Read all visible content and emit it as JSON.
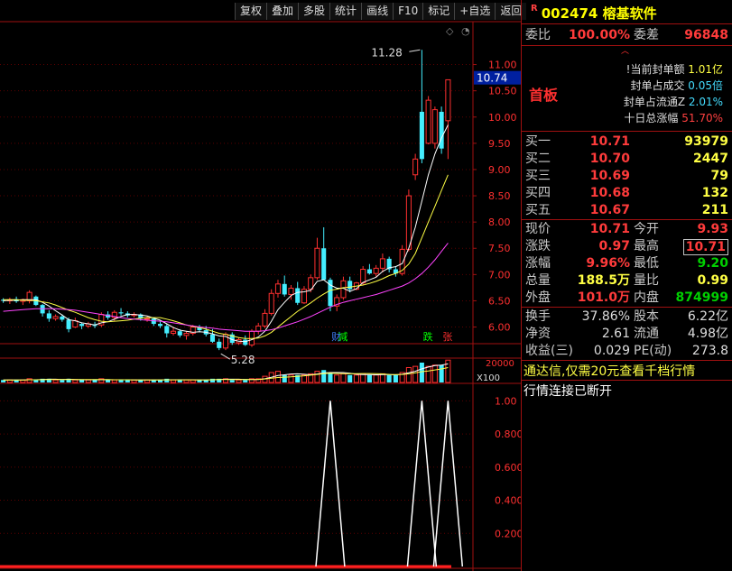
{
  "toolbar": {
    "buttons": [
      "复权",
      "叠加",
      "多股",
      "统计",
      "画线",
      "F10",
      "标记",
      "+自选",
      "返回"
    ]
  },
  "stock": {
    "r_tag": "R",
    "code": "002474",
    "name": "榕基软件"
  },
  "order_book": {
    "weibi_label": "委比",
    "weibi_value": "100.00%",
    "weicha_label": "委差",
    "weicha_value": "96848",
    "board_label": "首板",
    "seal": [
      {
        "label": "!当前封单额",
        "value": "1.01亿"
      },
      {
        "label": "封单占成交",
        "value": "0.05倍"
      },
      {
        "label": "封单占流通Z",
        "value": "2.01%"
      },
      {
        "label": "十日总涨幅",
        "value": "51.70%"
      }
    ],
    "buy": [
      {
        "label": "买一",
        "price": "10.71",
        "vol": "93979"
      },
      {
        "label": "买二",
        "price": "10.70",
        "vol": "2447"
      },
      {
        "label": "买三",
        "price": "10.69",
        "vol": "79"
      },
      {
        "label": "买四",
        "price": "10.68",
        "vol": "132"
      },
      {
        "label": "买五",
        "price": "10.67",
        "vol": "211"
      }
    ]
  },
  "quote": [
    [
      {
        "label": "现价",
        "value": "10.71",
        "c": "red"
      },
      {
        "label": "今开",
        "value": "9.93",
        "c": "red"
      }
    ],
    [
      {
        "label": "涨跌",
        "value": "0.97",
        "c": "red"
      },
      {
        "label": "最高",
        "value": "10.71",
        "c": "red"
      }
    ],
    [
      {
        "label": "涨幅",
        "value": "9.96%",
        "c": "red"
      },
      {
        "label": "最低",
        "value": "9.20",
        "c": "grn"
      }
    ],
    [
      {
        "label": "总量",
        "value": "188.5万",
        "c": "yel"
      },
      {
        "label": "量比",
        "value": "0.99",
        "c": "yel"
      }
    ],
    [
      {
        "label": "外盘",
        "value": "101.0万",
        "c": "red"
      },
      {
        "label": "内盘",
        "value": "874999",
        "c": "grn"
      }
    ]
  ],
  "stats": [
    [
      {
        "label": "换手",
        "value": "37.86%"
      },
      {
        "label": "股本",
        "value": "6.22亿"
      }
    ],
    [
      {
        "label": "净资",
        "value": "2.61"
      },
      {
        "label": "流通",
        "value": "4.98亿"
      }
    ],
    [
      {
        "label": "收益(三)",
        "value": "0.029"
      },
      {
        "label": "PE(动)",
        "value": "273.8"
      }
    ]
  ],
  "promo": "通达信,仅需20元查看千档行情",
  "connection_status": "行情连接已断开",
  "colors": {
    "up": "#ff3030",
    "down": "#44eeff",
    "ma5": "#ffffff",
    "ma10": "#ffff44",
    "ma20": "#ff44ff",
    "frame": "#a01010"
  },
  "chart_data": [
    {
      "type": "candlestick",
      "title": "",
      "ylim": [
        5.7,
        11.8
      ],
      "y_ticks": [
        "11.00",
        "10.50",
        "10.00",
        "9.50",
        "9.00",
        "8.50",
        "8.00",
        "7.50",
        "7.00",
        "6.50",
        "6.00"
      ],
      "current_price_tag": "10.74",
      "annotations": {
        "high": "11.28",
        "low": "5.28"
      },
      "markers": [
        {
          "text": "财",
          "color": "#4080ff"
        },
        {
          "text": "减",
          "color": "#00ff00"
        },
        {
          "text": "跌",
          "color": "#00ff00"
        },
        {
          "text": "张",
          "color": "#ff3030"
        }
      ],
      "candles": [
        [
          6.52,
          6.55,
          6.46,
          6.5
        ],
        [
          6.5,
          6.56,
          6.44,
          6.52
        ],
        [
          6.53,
          6.58,
          6.46,
          6.49
        ],
        [
          6.49,
          6.54,
          6.42,
          6.52
        ],
        [
          6.5,
          6.7,
          6.45,
          6.66
        ],
        [
          6.58,
          6.6,
          6.4,
          6.42
        ],
        [
          6.42,
          6.44,
          6.2,
          6.26
        ],
        [
          6.26,
          6.32,
          6.1,
          6.16
        ],
        [
          6.16,
          6.24,
          6.12,
          6.2
        ],
        [
          6.2,
          6.24,
          6.1,
          6.14
        ],
        [
          6.14,
          6.18,
          5.9,
          5.96
        ],
        [
          6.0,
          6.18,
          5.98,
          6.12
        ],
        [
          6.06,
          6.08,
          5.96,
          6.02
        ],
        [
          6.02,
          6.1,
          5.98,
          6.06
        ],
        [
          6.04,
          6.1,
          5.98,
          6.02
        ],
        [
          6.04,
          6.28,
          6.0,
          6.24
        ],
        [
          6.24,
          6.3,
          6.14,
          6.18
        ],
        [
          6.18,
          6.32,
          6.12,
          6.28
        ],
        [
          6.28,
          6.36,
          6.22,
          6.26
        ],
        [
          6.26,
          6.3,
          6.18,
          6.22
        ],
        [
          6.22,
          6.28,
          6.18,
          6.24
        ],
        [
          6.24,
          6.26,
          6.12,
          6.16
        ],
        [
          6.16,
          6.2,
          6.1,
          6.16
        ],
        [
          6.16,
          6.18,
          6.02,
          6.06
        ],
        [
          6.06,
          6.1,
          5.98,
          6.02
        ],
        [
          6.02,
          6.06,
          5.8,
          5.88
        ],
        [
          5.88,
          6.0,
          5.84,
          5.92
        ],
        [
          5.92,
          5.96,
          5.8,
          5.84
        ],
        [
          5.84,
          5.92,
          5.76,
          5.88
        ],
        [
          5.88,
          6.04,
          5.84,
          6.0
        ],
        [
          6.0,
          6.04,
          5.9,
          5.94
        ],
        [
          5.94,
          6.02,
          5.82,
          5.86
        ],
        [
          5.86,
          5.96,
          5.7,
          5.72
        ],
        [
          5.72,
          5.78,
          5.56,
          5.6
        ],
        [
          5.6,
          5.9,
          5.56,
          5.86
        ],
        [
          5.86,
          5.9,
          5.66,
          5.7
        ],
        [
          5.7,
          5.8,
          5.66,
          5.76
        ],
        [
          5.76,
          5.84,
          5.64,
          5.66
        ],
        [
          5.66,
          5.96,
          5.62,
          5.92
        ],
        [
          5.92,
          6.08,
          5.86,
          6.02
        ],
        [
          6.02,
          6.34,
          5.98,
          6.26
        ],
        [
          6.26,
          6.72,
          6.22,
          6.64
        ],
        [
          6.64,
          6.9,
          6.56,
          6.82
        ],
        [
          6.82,
          6.98,
          6.58,
          6.62
        ],
        [
          6.62,
          6.8,
          6.52,
          6.74
        ],
        [
          6.74,
          6.86,
          6.42,
          6.46
        ],
        [
          6.46,
          6.78,
          6.44,
          6.72
        ],
        [
          6.72,
          7.0,
          6.66,
          6.94
        ],
        [
          6.94,
          7.7,
          6.9,
          7.5
        ],
        [
          7.5,
          7.9,
          7.0,
          6.9
        ],
        [
          6.9,
          6.94,
          6.3,
          6.4
        ],
        [
          6.4,
          6.62,
          6.3,
          6.56
        ],
        [
          6.56,
          6.96,
          6.52,
          6.88
        ],
        [
          6.88,
          6.96,
          6.66,
          6.72
        ],
        [
          6.72,
          6.86,
          6.7,
          6.84
        ],
        [
          6.84,
          7.16,
          6.8,
          7.1
        ],
        [
          7.1,
          7.2,
          7.0,
          7.02
        ],
        [
          7.02,
          7.18,
          6.96,
          7.12
        ],
        [
          7.12,
          7.4,
          7.04,
          7.3
        ],
        [
          7.3,
          7.34,
          7.04,
          7.1
        ],
        [
          7.1,
          7.16,
          6.96,
          7.02
        ],
        [
          7.02,
          7.56,
          6.98,
          7.48
        ],
        [
          7.48,
          8.62,
          7.44,
          8.5
        ],
        [
          8.9,
          9.3,
          8.8,
          9.2
        ],
        [
          10.1,
          11.28,
          9.12,
          9.2
        ],
        [
          9.5,
          10.4,
          9.48,
          10.32
        ],
        [
          9.5,
          10.2,
          9.4,
          10.14
        ],
        [
          10.1,
          10.2,
          9.3,
          9.4
        ],
        [
          9.93,
          10.71,
          9.2,
          10.71
        ]
      ],
      "ma": [
        {
          "name": "MA5",
          "color": "#ffffff",
          "values": [
            6.5,
            6.51,
            6.51,
            6.52,
            6.52,
            6.52,
            6.47,
            6.4,
            6.31,
            6.23,
            6.14,
            6.12,
            6.08,
            6.06,
            6.04,
            6.08,
            6.1,
            6.15,
            6.2,
            6.24,
            6.24,
            6.23,
            6.21,
            6.17,
            6.13,
            6.06,
            5.99,
            5.94,
            5.92,
            5.9,
            5.91,
            5.9,
            5.87,
            5.83,
            5.82,
            5.76,
            5.73,
            5.72,
            5.76,
            5.81,
            5.92,
            6.11,
            6.33,
            6.47,
            6.6,
            6.66,
            6.67,
            6.7,
            6.87,
            6.9,
            6.8,
            6.74,
            6.74,
            6.68,
            6.73,
            6.85,
            6.9,
            6.95,
            7.06,
            7.13,
            7.15,
            7.21,
            7.5,
            7.9,
            8.4,
            8.9,
            9.3,
            9.6,
            9.85
          ]
        },
        {
          "name": "MA10",
          "color": "#ffff44",
          "values": [
            6.52,
            6.52,
            6.52,
            6.51,
            6.51,
            6.5,
            6.48,
            6.46,
            6.42,
            6.37,
            6.32,
            6.28,
            6.23,
            6.18,
            6.14,
            6.11,
            6.1,
            6.11,
            6.12,
            6.13,
            6.15,
            6.17,
            6.18,
            6.18,
            6.18,
            6.15,
            6.12,
            6.08,
            6.04,
            6.01,
            5.99,
            5.96,
            5.92,
            5.88,
            5.86,
            5.83,
            5.8,
            5.78,
            5.78,
            5.79,
            5.83,
            5.9,
            6.0,
            6.1,
            6.2,
            6.3,
            6.38,
            6.46,
            6.55,
            6.63,
            6.7,
            6.72,
            6.75,
            6.76,
            6.78,
            6.8,
            6.83,
            6.87,
            6.92,
            6.98,
            7.02,
            7.08,
            7.2,
            7.4,
            7.7,
            8.0,
            8.3,
            8.6,
            8.9
          ]
        },
        {
          "name": "MA20",
          "color": "#ff44ff",
          "values": [
            6.3,
            6.31,
            6.32,
            6.33,
            6.34,
            6.35,
            6.35,
            6.35,
            6.35,
            6.34,
            6.33,
            6.32,
            6.3,
            6.28,
            6.26,
            6.24,
            6.22,
            6.2,
            6.18,
            6.16,
            6.15,
            6.14,
            6.13,
            6.12,
            6.11,
            6.1,
            6.08,
            6.06,
            6.04,
            6.02,
            6.0,
            5.99,
            5.98,
            5.96,
            5.95,
            5.94,
            5.93,
            5.92,
            5.92,
            5.92,
            5.93,
            5.95,
            5.98,
            6.02,
            6.06,
            6.1,
            6.15,
            6.2,
            6.26,
            6.32,
            6.38,
            6.43,
            6.47,
            6.5,
            6.53,
            6.56,
            6.59,
            6.62,
            6.66,
            6.7,
            6.74,
            6.78,
            6.84,
            6.92,
            7.02,
            7.14,
            7.28,
            7.44,
            7.6
          ]
        }
      ]
    },
    {
      "type": "bar",
      "title": "",
      "y_tick": "20000",
      "unit_label": "X100",
      "values": [
        2,
        2,
        2,
        2,
        3,
        2,
        3,
        3,
        2,
        2,
        3,
        2,
        2,
        2,
        2,
        3,
        2,
        2,
        2,
        2,
        2,
        2,
        2,
        2,
        2,
        3,
        2,
        2,
        2,
        2,
        2,
        2,
        3,
        3,
        3,
        2,
        2,
        2,
        3,
        3,
        5,
        8,
        9,
        6,
        6,
        6,
        6,
        7,
        9,
        10,
        8,
        6,
        7,
        6,
        6,
        7,
        6,
        6,
        7,
        6,
        6,
        8,
        12,
        13,
        16,
        13,
        14,
        14,
        18
      ]
    },
    {
      "type": "line",
      "title": "",
      "ylim": [
        0,
        1.1
      ],
      "y_ticks": [
        "1.00",
        "0.800",
        "0.600",
        "0.400",
        "0.200"
      ],
      "values": [
        0,
        0,
        0,
        0,
        0,
        0,
        0,
        0,
        0,
        0,
        0,
        0,
        0,
        0,
        0,
        0,
        0,
        0,
        0,
        0,
        0,
        0,
        0,
        0,
        0,
        0,
        0,
        0,
        0,
        0,
        0,
        0,
        0,
        0,
        0,
        0,
        0,
        0,
        0,
        0,
        0,
        0,
        0,
        0,
        0,
        0,
        0,
        0,
        0,
        0,
        1,
        0,
        0,
        0,
        0,
        0,
        0,
        0,
        0,
        0,
        0,
        0,
        0,
        0,
        1,
        0,
        0,
        0,
        1
      ]
    }
  ]
}
